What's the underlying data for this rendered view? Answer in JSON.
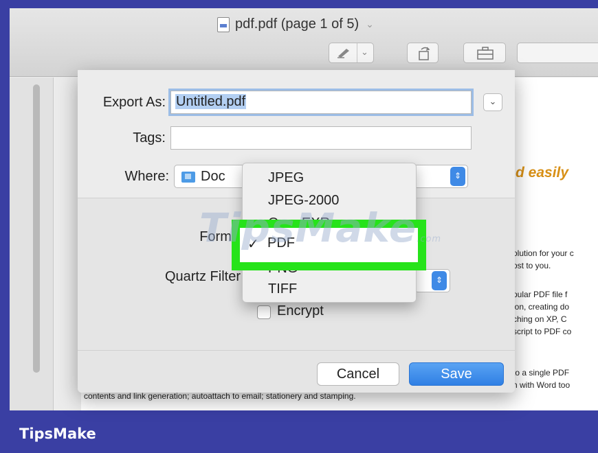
{
  "window": {
    "title": "pdf.pdf (page 1 of 5)"
  },
  "document": {
    "heading_fragment": "d easily",
    "paragraph_lines": [
      "olution for your c",
      "ost to you.",
      "pular PDF file f",
      "ion, creating do",
      "ching on XP, C",
      "script to PDF co",
      "to a single PDF",
      "n with Word too"
    ],
    "bottom_line": "contents and link generation; autoattach to email; stationery and stamping."
  },
  "dialog": {
    "export_as_label": "Export As:",
    "export_as_value": "Untitled.pdf",
    "tags_label": "Tags:",
    "tags_value": "",
    "where_label": "Where:",
    "where_value": "Doc",
    "format_label": "Forma",
    "quartz_label": "Quartz Filter",
    "encrypt_label": "Encrypt",
    "cancel_label": "Cancel",
    "save_label": "Save"
  },
  "format_menu": {
    "items": [
      "JPEG",
      "JPEG-2000",
      "OpenEXR",
      "PDF",
      "PNG",
      "TIFF"
    ],
    "selected": "PDF",
    "check_mark": "✓"
  },
  "watermark": {
    "text": "TipsMake",
    "suffix": ".com"
  },
  "brand": {
    "label": "TipsMake"
  },
  "colors": {
    "frame": "#3a3fa3",
    "highlight": "#26e31a",
    "accent": "#3f8ae6",
    "heading": "#d89016"
  }
}
